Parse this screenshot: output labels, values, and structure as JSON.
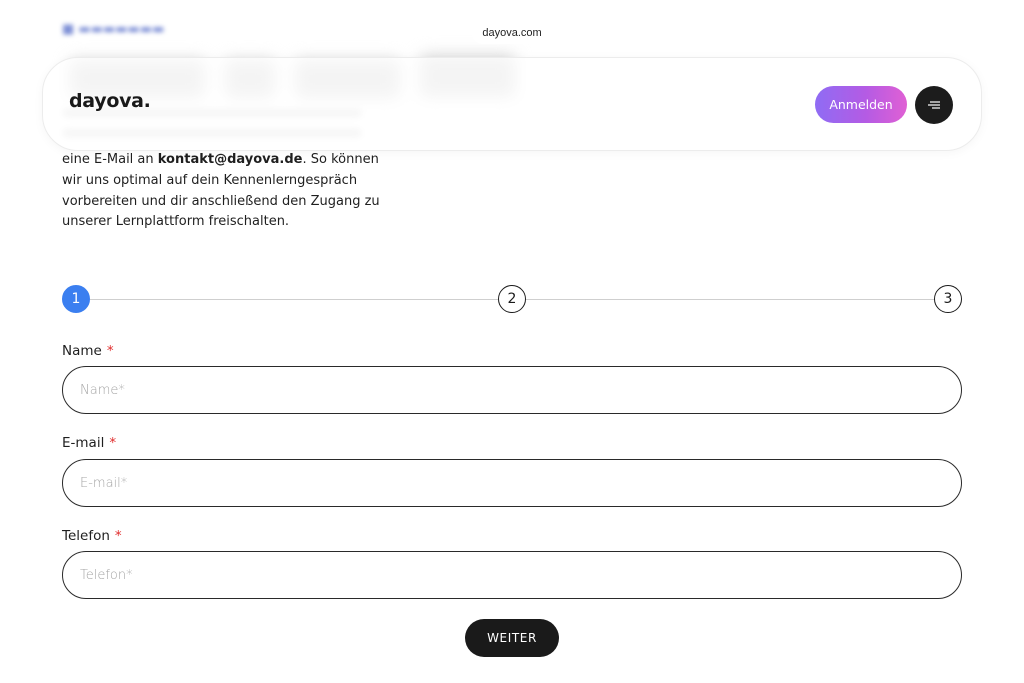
{
  "browser": {
    "url": "dayova.com"
  },
  "header": {
    "logo": "dayova.",
    "login_label": "Anmelden",
    "menu_icon": "menu-icon"
  },
  "intro": {
    "text_before": "eine E-Mail an ",
    "email": "kontakt@dayova.de",
    "text_after": ". So können wir uns optimal auf dein Kennenlerngespräch vorbereiten und dir anschließend den Zugang zu unserer Lernplattform freischalten."
  },
  "stepper": {
    "steps": [
      "1",
      "2",
      "3"
    ],
    "active_step": 1,
    "active_color": "#3b7ff0"
  },
  "form": {
    "fields": [
      {
        "label": "Name",
        "required_mark": "*",
        "placeholder": "Name*",
        "value": ""
      },
      {
        "label": "E-mail",
        "required_mark": "*",
        "placeholder": "E-mail*",
        "value": ""
      },
      {
        "label": "Telefon",
        "required_mark": "*",
        "placeholder": "Telefon*",
        "value": ""
      }
    ],
    "submit_label": "WEITER"
  },
  "colors": {
    "brand_gradient_start": "#8f6cf4",
    "brand_gradient_end": "#e060d4",
    "required": "#e02b2b",
    "button_dark": "#1a1a1a"
  }
}
